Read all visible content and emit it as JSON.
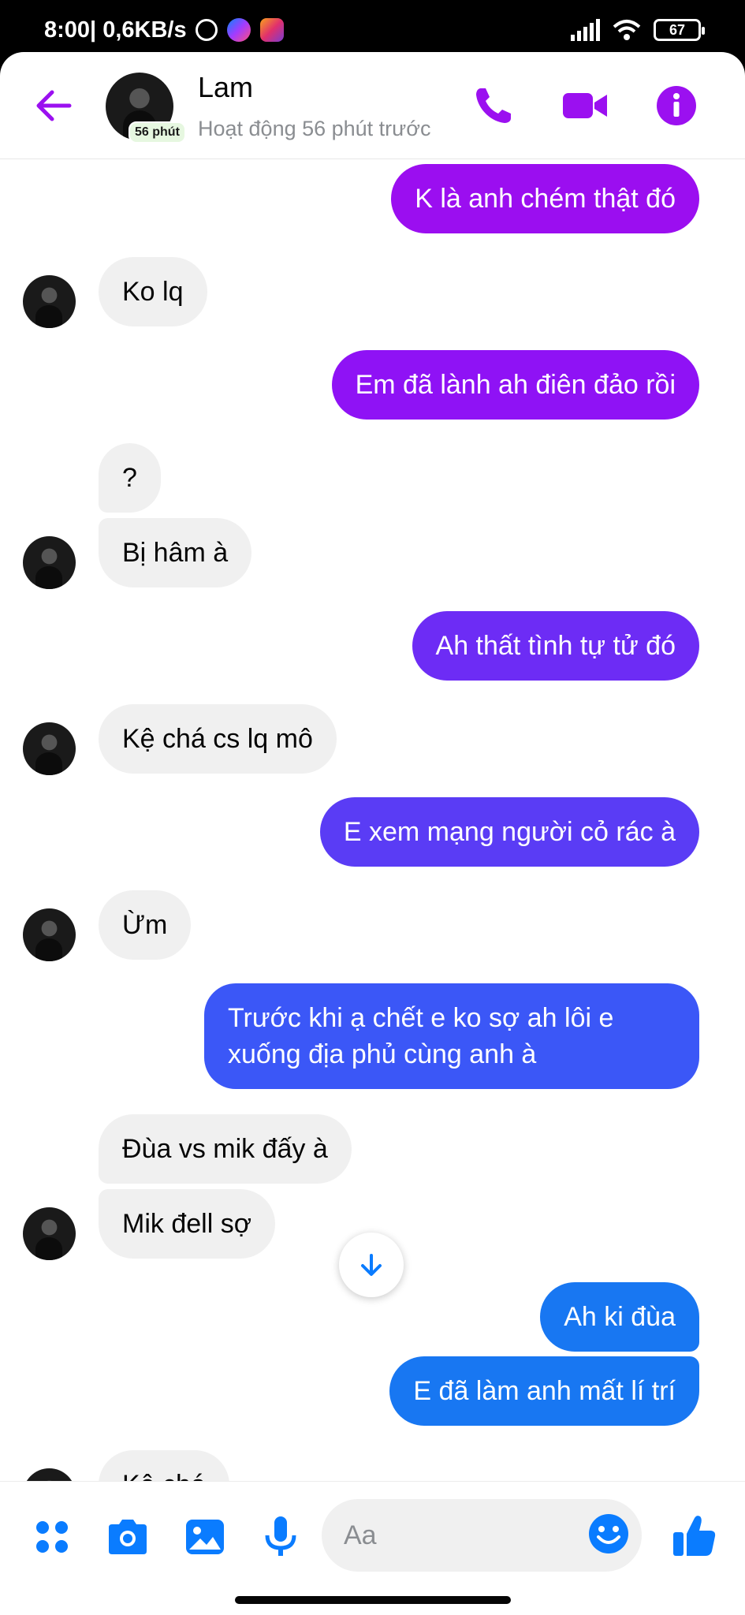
{
  "status_bar": {
    "time": "8:00",
    "network_speed": "| 0,6KB/s",
    "battery": "67",
    "icons": [
      "alarm-icon",
      "messenger-icon",
      "instagram-icon",
      "signal-icon",
      "wifi-icon",
      "battery-icon"
    ]
  },
  "header": {
    "contact_name": "Lam",
    "active_badge": "56 phút",
    "status": "Hoạt động 56 phút trước",
    "icons": [
      "back-arrow-icon",
      "phone-icon",
      "video-icon",
      "info-icon"
    ],
    "accent_color": "#9b10f0"
  },
  "messages": [
    {
      "dir": "out",
      "text": "K là anh chém thật đó",
      "color": "#9b0ef0"
    },
    {
      "dir": "in",
      "text": "Ko lq"
    },
    {
      "dir": "out",
      "text": "Em đã lành ah điên đảo rồi",
      "color": "#8f12f5"
    },
    {
      "dir": "in",
      "text": "?"
    },
    {
      "dir": "in",
      "text": "Bị hâm à"
    },
    {
      "dir": "out",
      "text": "Ah thất tình tự tử đó",
      "color": "#6d2cf5"
    },
    {
      "dir": "in",
      "text": "Kệ chá cs lq mô"
    },
    {
      "dir": "out",
      "text": "E xem mạng người cỏ rác à",
      "color": "#5a3cf5"
    },
    {
      "dir": "in",
      "text": "Ừm"
    },
    {
      "dir": "out",
      "text_line1": "Trước khi ạ chết  e ko sợ ah lôi e",
      "text_line2": "xuống địa phủ cùng anh à",
      "color": "#3b57f7"
    },
    {
      "dir": "in",
      "text": "Đùa vs mik đấy à"
    },
    {
      "dir": "in",
      "text": "Mik đell sợ"
    },
    {
      "dir": "out",
      "text": "Ah ki đùa",
      "color": "#1877f2"
    },
    {
      "dir": "out",
      "text": "E đã làm anh mất lí trí",
      "color": "#1877f2"
    },
    {
      "dir": "in",
      "text": "Kệ chá"
    }
  ],
  "composer": {
    "placeholder": "Aa",
    "icons": [
      "apps-icon",
      "camera-icon",
      "gallery-icon",
      "microphone-icon",
      "emoji-icon",
      "like-icon"
    ],
    "accent_color": "#0a7cff"
  },
  "scroll_down_icon": "arrow-down-icon"
}
